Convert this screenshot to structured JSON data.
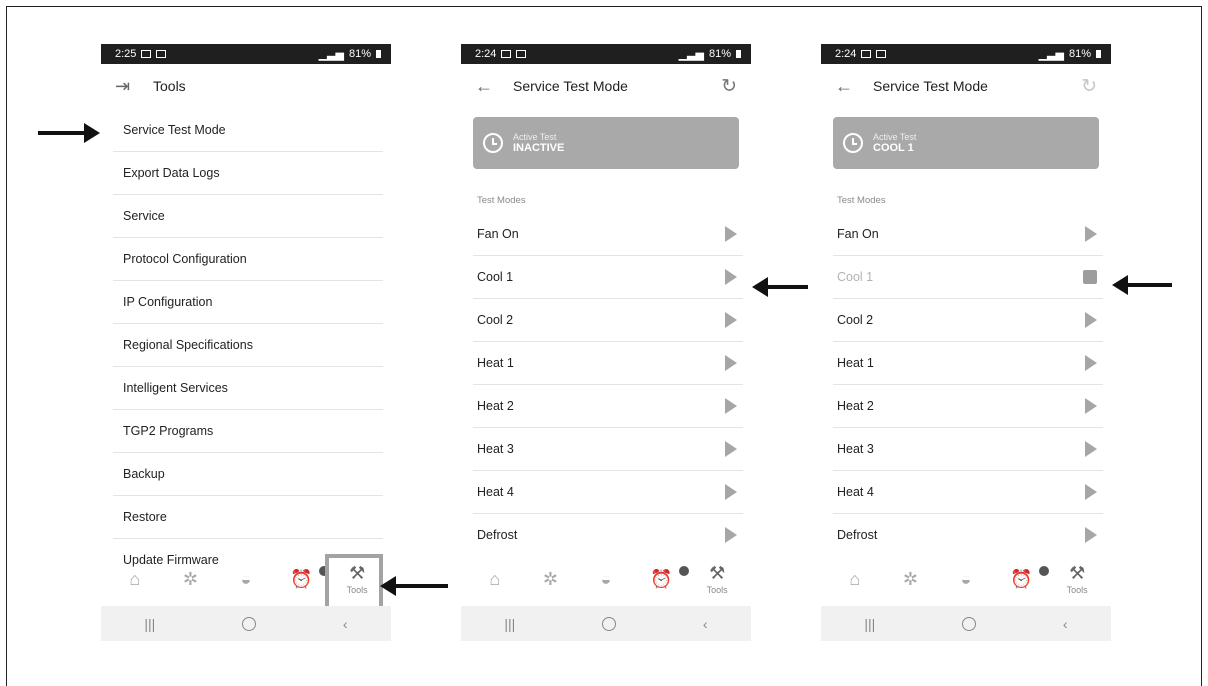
{
  "phone1": {
    "status": {
      "time": "2:25",
      "battery": "81%"
    },
    "header": {
      "title": "Tools"
    },
    "items": [
      "Service Test Mode",
      "Export Data Logs",
      "Service",
      "Protocol Configuration",
      "IP Configuration",
      "Regional Specifications",
      "Intelligent Services",
      "TGP2 Programs",
      "Backup",
      "Restore",
      "Update Firmware"
    ],
    "nav": {
      "tools_label": "Tools"
    }
  },
  "phone2": {
    "status": {
      "time": "2:24",
      "battery": "81%"
    },
    "header": {
      "title": "Service Test Mode"
    },
    "active_test": {
      "label": "Active Test",
      "value": "INACTIVE"
    },
    "section_label": "Test Modes",
    "modes": [
      "Fan On",
      "Cool 1",
      "Cool 2",
      "Heat 1",
      "Heat 2",
      "Heat 3",
      "Heat 4",
      "Defrost"
    ],
    "nav": {
      "tools_label": "Tools"
    }
  },
  "phone3": {
    "status": {
      "time": "2:24",
      "battery": "81%"
    },
    "header": {
      "title": "Service Test Mode"
    },
    "active_test": {
      "label": "Active Test",
      "value": "COOL 1"
    },
    "section_label": "Test Modes",
    "modes": [
      "Fan On",
      "Cool 1",
      "Cool 2",
      "Heat 1",
      "Heat 2",
      "Heat 3",
      "Heat 4",
      "Defrost"
    ],
    "running_mode_index": 1,
    "nav": {
      "tools_label": "Tools"
    }
  },
  "colors": {
    "card_bg": "#a9a9a9",
    "arrow": "#111111",
    "status_bar": "#1f1f1f"
  },
  "icons": [
    "back-arrow-icon",
    "refresh-icon",
    "clock-icon",
    "play-icon",
    "stop-icon",
    "home-icon",
    "gear-icon",
    "gauge-icon",
    "alarm-icon",
    "tools-icon"
  ]
}
